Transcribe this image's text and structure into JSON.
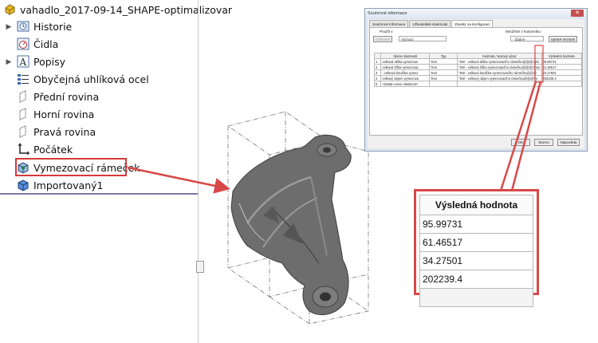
{
  "tree": {
    "root": "vahadlo_2017-09-14_SHAPE-optimalizovar",
    "items": [
      {
        "label": "Historie",
        "icon": "history-icon",
        "expandable": true
      },
      {
        "label": "Čidla",
        "icon": "sensors-icon",
        "expandable": false
      },
      {
        "label": "Popisy",
        "icon": "annotations-icon",
        "expandable": true
      },
      {
        "label": "Obyčejná uhlíková ocel",
        "icon": "material-icon",
        "expandable": false
      },
      {
        "label": "Přední rovina",
        "icon": "plane-icon",
        "expandable": false
      },
      {
        "label": "Horní rovina",
        "icon": "plane-icon",
        "expandable": false
      },
      {
        "label": "Pravá rovina",
        "icon": "plane-icon",
        "expandable": false
      },
      {
        "label": "Počátek",
        "icon": "origin-icon",
        "expandable": false
      },
      {
        "label": "Vymezovací rámeček",
        "icon": "bounding-box-icon",
        "expandable": false
      },
      {
        "label": "Importovaný1",
        "icon": "imported-body-icon",
        "expandable": false
      }
    ]
  },
  "dialog": {
    "title": "Souhrnné informace",
    "close_label": "✕",
    "tabs": [
      "Souhrnné informace",
      "Uživatelské vlastnosti",
      "Závislý na konfiguraci"
    ],
    "applies_to_label": "Použít v",
    "applies_to_value": "Výchozí",
    "delete_button": "Odstranit",
    "bom_label": "Množství v kusovníku",
    "bom_value": "- Žádné -",
    "edit_list_button": "Upravit seznam",
    "columns": [
      "",
      "Název vlastnosti",
      "Typ",
      "Hodnota / textový výraz",
      "Výsledná hodnota"
    ],
    "rows": [
      [
        "1",
        "celková délka vymezova",
        "Text",
        "\"SW - celková délka vymezovacího rámečku@@@Vým",
        "95.99731"
      ],
      [
        "2",
        "celková šířka vymezovac",
        "Text",
        "\"SW - celková šířka vymezovacího rámečku@@@Vyme",
        "61.46517"
      ],
      [
        "3",
        "- celková tloušťka vymez",
        "Text",
        "\"SW - celková tloušťka vymezovacího rámečku@@@",
        "34.27501"
      ],
      [
        "4",
        "celkový objem vymezova",
        "Text",
        "\"SW - celkový objem vymezovacího rámečku@@@Vy",
        "202239.4"
      ],
      [
        "5",
        "<Zadat novou vlastnost>",
        "",
        "",
        ""
      ]
    ],
    "ok_button": "OK",
    "cancel_button": "Storno",
    "help_button": "Nápověda"
  },
  "zoom": {
    "header": "Výsledná hodnota",
    "values": [
      "95.99731",
      "61.46517",
      "34.27501",
      "202239.4",
      ""
    ]
  },
  "colors": {
    "highlight": "#d53a3a",
    "model": "#6d6d6d",
    "tree_separator": "#7a7aa8"
  }
}
